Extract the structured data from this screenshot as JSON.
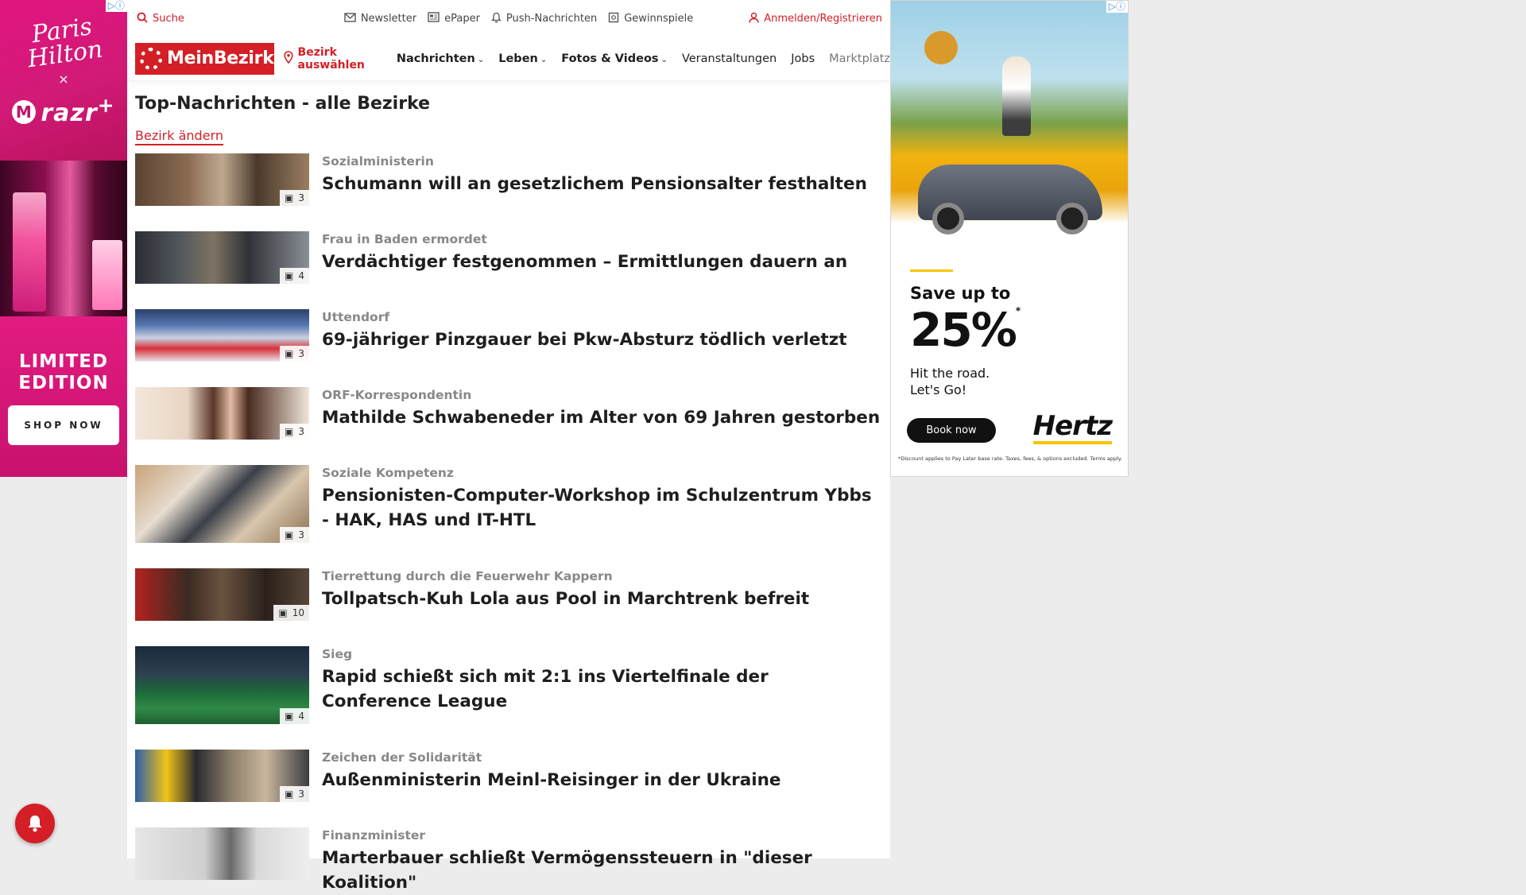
{
  "left_ad": {
    "brand_signature": "Paris Hilton",
    "cross": "×",
    "product": "razr",
    "product_plus": "+",
    "headline": "LIMITED EDITION",
    "cta": "SHOP NOW",
    "ad_choice": "▷ⓘ"
  },
  "topbar": {
    "search": "Suche",
    "newsletter": "Newsletter",
    "epaper": "ePaper",
    "push": "Push-Nachrichten",
    "gewinnspiele": "Gewinnspiele",
    "login": "Anmelden/Registrieren"
  },
  "nav": {
    "logo": "MeinBezirk",
    "bezirk": "Bezirk auswählen",
    "items": [
      {
        "label": "Nachrichten",
        "dropdown": true
      },
      {
        "label": "Leben",
        "dropdown": true
      },
      {
        "label": "Fotos & Videos",
        "dropdown": true
      },
      {
        "label": "Veranstaltungen",
        "dropdown": false
      },
      {
        "label": "Jobs",
        "dropdown": false
      },
      {
        "label": "Marktplatz",
        "dropdown": false
      }
    ]
  },
  "page": {
    "title": "Top-Nachrichten - alle Bezirke",
    "change_link": "Bezirk ändern"
  },
  "articles": [
    {
      "kicker": "Sozialministerin",
      "headline": "Schumann will an gesetzlichem Pensionsalter festhalten",
      "photos": "3"
    },
    {
      "kicker": "Frau in Baden ermordet",
      "headline": "Verdächtiger festgenommen – Ermittlungen dauern an",
      "photos": "4"
    },
    {
      "kicker": "Uttendorf",
      "headline": "69-jähriger Pinzgauer bei Pkw-Absturz tödlich verletzt",
      "photos": "3"
    },
    {
      "kicker": "ORF-Korrespondentin",
      "headline": "Mathilde Schwabeneder im Alter von 69 Jahren gestorben",
      "photos": "3"
    },
    {
      "kicker": "Soziale Kompetenz",
      "headline": "Pensionisten-Computer-Workshop im Schulzentrum Ybbs - HAK, HAS und IT-HTL",
      "photos": "3"
    },
    {
      "kicker": "Tierrettung durch die Feuerwehr Kappern",
      "headline": "Tollpatsch-Kuh Lola aus Pool in Marchtrenk befreit",
      "photos": "10"
    },
    {
      "kicker": "Sieg",
      "headline": "Rapid schießt sich mit 2:1 ins Viertelfinale der Conference League",
      "photos": "4"
    },
    {
      "kicker": "Zeichen der Solidarität",
      "headline": "Außenministerin Meinl-Reisinger in der Ukraine",
      "photos": "3"
    },
    {
      "kicker": "Finanzminister",
      "headline": "Marterbauer schließt Vermögenssteuern in \"dieser Koalition\"",
      "photos": ""
    }
  ],
  "right_ad": {
    "save": "Save up to",
    "percent": "25%",
    "asterisk": "*",
    "tagline_1": "Hit the road.",
    "tagline_2": "Let's Go!",
    "cta": "Book now",
    "brand": "Hertz",
    "disclaimer": "*Discount applies to Pay Later base rate. Taxes, fees, & options excluded. Terms apply.",
    "ad_choice": "▷ⓘ"
  },
  "colors": {
    "brand_red": "#d41f26",
    "ad_pink": "#e21b80",
    "hertz_yellow": "#f7c600"
  },
  "icons": [
    "search-icon",
    "envelope-icon",
    "newspaper-icon",
    "bell-icon",
    "gift-icon",
    "user-icon",
    "map-pin-icon",
    "chevron-down-icon",
    "camera-icon",
    "notification-bell-icon"
  ]
}
